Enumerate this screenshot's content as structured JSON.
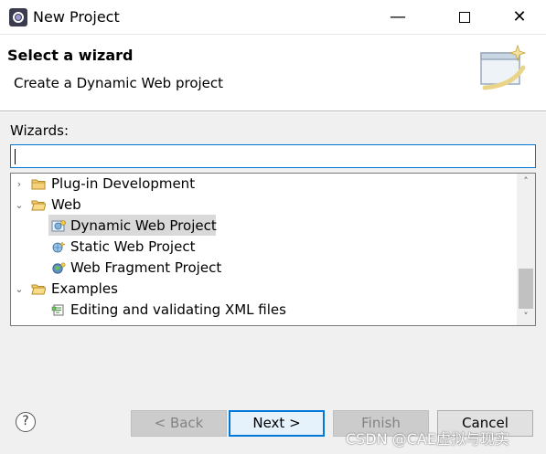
{
  "window": {
    "title": "New Project",
    "controls": {
      "minimize": "—",
      "close": "✕"
    }
  },
  "banner": {
    "title": "Select a wizard",
    "description": "Create a Dynamic Web project"
  },
  "filter": {
    "label": "Wizards:",
    "value": ""
  },
  "tree": {
    "items": [
      {
        "label": "Plug-in Development",
        "icon": "folder-icon",
        "twisty": "›",
        "expanded": false
      },
      {
        "label": "Web",
        "icon": "folder-icon",
        "twisty": "⌄",
        "expanded": true
      },
      {
        "label": "Dynamic Web Project",
        "icon": "dynamic-web-project-icon",
        "selected": true
      },
      {
        "label": "Static Web Project",
        "icon": "static-web-project-icon"
      },
      {
        "label": "Web Fragment Project",
        "icon": "web-fragment-project-icon"
      },
      {
        "label": "Examples",
        "icon": "folder-icon",
        "twisty": "⌄",
        "expanded": true
      },
      {
        "label": "Editing and validating XML files",
        "icon": "xml-example-icon"
      }
    ],
    "scroll_up": "˄",
    "scroll_down": "˅"
  },
  "footer": {
    "help": "?",
    "back": "< Back",
    "next": "Next >",
    "finish": "Finish",
    "cancel": "Cancel"
  },
  "watermark": "CSDN @CAE虚拟与现实",
  "colors": {
    "accent": "#0078d7",
    "selection": "#d9d9d9",
    "folder": "#e8b84a",
    "dialog_bg": "#f0f0f0"
  }
}
